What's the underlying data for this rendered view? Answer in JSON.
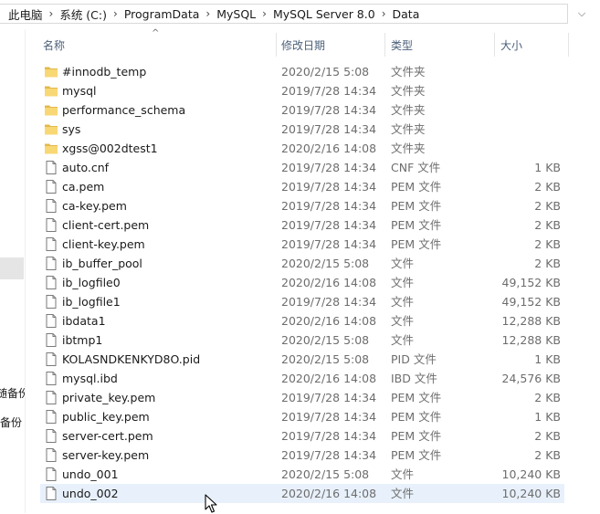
{
  "breadcrumb": [
    "此电脑",
    "系统 (C:)",
    "ProgramData",
    "MySQL",
    "MySQL Server 8.0",
    "Data"
  ],
  "breadcrumb_separator": "›",
  "dropdown_glyph": "⌵",
  "sort_glyph": "^",
  "nav_fragments": [
    "随备份",
    "备份"
  ],
  "columns": {
    "name": "名称",
    "date": "修改日期",
    "type": "类型",
    "size": "大小"
  },
  "files": [
    {
      "name": "#innodb_temp",
      "date": "2020/2/15 5:08",
      "type": "文件夹",
      "size": "",
      "icon": "folder-icon"
    },
    {
      "name": "mysql",
      "date": "2019/7/28 14:34",
      "type": "文件夹",
      "size": "",
      "icon": "folder-icon"
    },
    {
      "name": "performance_schema",
      "date": "2019/7/28 14:34",
      "type": "文件夹",
      "size": "",
      "icon": "folder-icon"
    },
    {
      "name": "sys",
      "date": "2019/7/28 14:34",
      "type": "文件夹",
      "size": "",
      "icon": "folder-icon"
    },
    {
      "name": "xgss@002dtest1",
      "date": "2020/2/16 14:08",
      "type": "文件夹",
      "size": "",
      "icon": "folder-icon"
    },
    {
      "name": "auto.cnf",
      "date": "2019/7/28 14:34",
      "type": "CNF 文件",
      "size": "1 KB",
      "icon": "file-icon"
    },
    {
      "name": "ca.pem",
      "date": "2019/7/28 14:34",
      "type": "PEM 文件",
      "size": "2 KB",
      "icon": "file-icon"
    },
    {
      "name": "ca-key.pem",
      "date": "2019/7/28 14:34",
      "type": "PEM 文件",
      "size": "2 KB",
      "icon": "file-icon"
    },
    {
      "name": "client-cert.pem",
      "date": "2019/7/28 14:34",
      "type": "PEM 文件",
      "size": "2 KB",
      "icon": "file-icon"
    },
    {
      "name": "client-key.pem",
      "date": "2019/7/28 14:34",
      "type": "PEM 文件",
      "size": "2 KB",
      "icon": "file-icon"
    },
    {
      "name": "ib_buffer_pool",
      "date": "2020/2/15 5:08",
      "type": "文件",
      "size": "2 KB",
      "icon": "file-icon"
    },
    {
      "name": "ib_logfile0",
      "date": "2020/2/16 14:08",
      "type": "文件",
      "size": "49,152 KB",
      "icon": "file-icon"
    },
    {
      "name": "ib_logfile1",
      "date": "2019/7/28 14:34",
      "type": "文件",
      "size": "49,152 KB",
      "icon": "file-icon"
    },
    {
      "name": "ibdata1",
      "date": "2020/2/16 14:08",
      "type": "文件",
      "size": "12,288 KB",
      "icon": "file-icon"
    },
    {
      "name": "ibtmp1",
      "date": "2020/2/15 5:08",
      "type": "文件",
      "size": "12,288 KB",
      "icon": "file-icon"
    },
    {
      "name": "KOLASNDKENKYD8O.pid",
      "date": "2020/2/15 5:08",
      "type": "PID 文件",
      "size": "1 KB",
      "icon": "file-icon"
    },
    {
      "name": "mysql.ibd",
      "date": "2020/2/16 14:08",
      "type": "IBD 文件",
      "size": "24,576 KB",
      "icon": "file-icon"
    },
    {
      "name": "private_key.pem",
      "date": "2019/7/28 14:34",
      "type": "PEM 文件",
      "size": "2 KB",
      "icon": "file-icon"
    },
    {
      "name": "public_key.pem",
      "date": "2019/7/28 14:34",
      "type": "PEM 文件",
      "size": "1 KB",
      "icon": "file-icon"
    },
    {
      "name": "server-cert.pem",
      "date": "2019/7/28 14:34",
      "type": "PEM 文件",
      "size": "2 KB",
      "icon": "file-icon"
    },
    {
      "name": "server-key.pem",
      "date": "2019/7/28 14:34",
      "type": "PEM 文件",
      "size": "2 KB",
      "icon": "file-icon"
    },
    {
      "name": "undo_001",
      "date": "2020/2/15 5:08",
      "type": "文件",
      "size": "10,240 KB",
      "icon": "file-icon"
    },
    {
      "name": "undo_002",
      "date": "2020/2/16 14:08",
      "type": "文件",
      "size": "10,240 KB",
      "icon": "file-icon",
      "hovered": true
    }
  ],
  "colors": {
    "folder": "#f8d775",
    "folder_dark": "#e3b94b",
    "header_text": "#4c607a",
    "hover_row": "#e8f1fb"
  }
}
